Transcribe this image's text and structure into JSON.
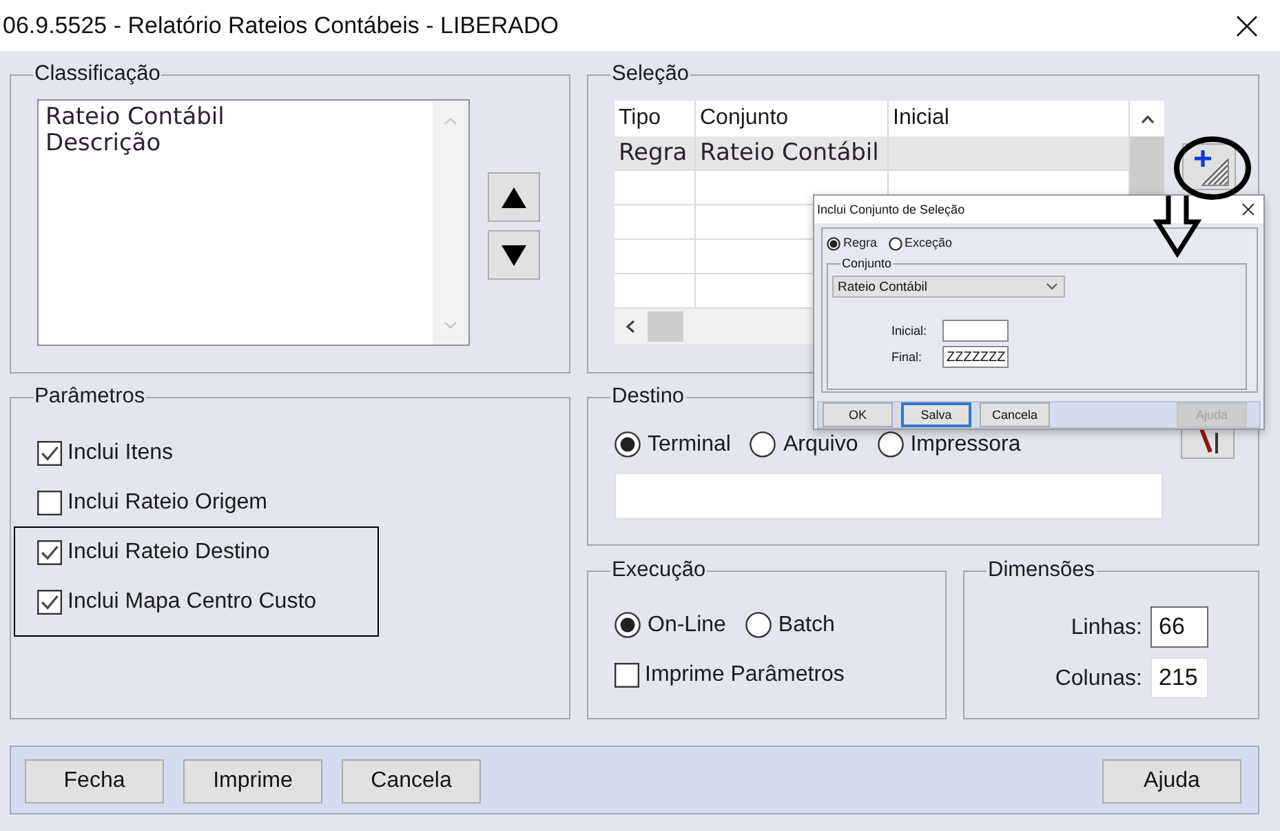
{
  "window": {
    "title": "06.9.5525 - Relatório Rateios Contábeis - LIBERADO"
  },
  "classificacao": {
    "title": "Classificação",
    "items": [
      "Rateio Contábil",
      "Descrição"
    ]
  },
  "selecao": {
    "title": "Seleção",
    "table": {
      "columns": [
        "Tipo",
        "Conjunto",
        "Inicial"
      ],
      "rows": [
        {
          "cells": [
            "Regra",
            "Rateio Contábil"
          ],
          "selected": true
        }
      ]
    }
  },
  "parametros": {
    "title": "Parâmetros",
    "options": [
      {
        "label": "Inclui Itens",
        "checked": true
      },
      {
        "label": "Inclui Rateio Origem",
        "checked": false
      },
      {
        "label": "Inclui Rateio Destino",
        "checked": true
      },
      {
        "label": "Inclui Mapa Centro Custo",
        "checked": true
      }
    ]
  },
  "destino": {
    "title": "Destino",
    "options": [
      {
        "label": "Terminal",
        "selected": true
      },
      {
        "label": "Arquivo",
        "selected": false
      },
      {
        "label": "Impressora",
        "selected": false
      }
    ]
  },
  "execucao": {
    "title": "Execução",
    "modes": [
      {
        "label": "On-Line",
        "selected": true
      },
      {
        "label": "Batch",
        "selected": false
      }
    ],
    "options": [
      {
        "label": "Imprime Parâmetros",
        "checked": false
      }
    ]
  },
  "dimensoes": {
    "title": "Dimensões",
    "fields": [
      {
        "label": "Linhas:",
        "value": "66",
        "focused": true
      },
      {
        "label": "Colunas:",
        "value": "215",
        "focused": false
      }
    ]
  },
  "footer": {
    "left_buttons": [
      "Fecha",
      "Imprime",
      "Cancela"
    ],
    "right_buttons": [
      "Ajuda"
    ]
  },
  "dialog": {
    "title": "Inclui Conjunto de Seleção",
    "modes": [
      {
        "label": "Regra",
        "selected": true
      },
      {
        "label": "Exceção",
        "selected": false
      }
    ],
    "conjunto": {
      "title": "Conjunto",
      "value": "Rateio Contábil"
    },
    "fields": [
      {
        "label": "Inicial:"
      },
      {
        "label": "Final:",
        "value": "ZZZZZZZ"
      }
    ],
    "left_buttons": [
      {
        "label": "OK",
        "focused": false,
        "disabled": false
      },
      {
        "label": "Salva",
        "focused": true,
        "disabled": false
      },
      {
        "label": "Cancela",
        "focused": false,
        "disabled": false
      }
    ],
    "right_buttons": [
      {
        "label": "Ajuda",
        "focused": false,
        "disabled": true
      }
    ]
  },
  "annotations": [
    {
      "kind": "circle"
    },
    {
      "kind": "arrow"
    },
    {
      "kind": "frame"
    }
  ]
}
